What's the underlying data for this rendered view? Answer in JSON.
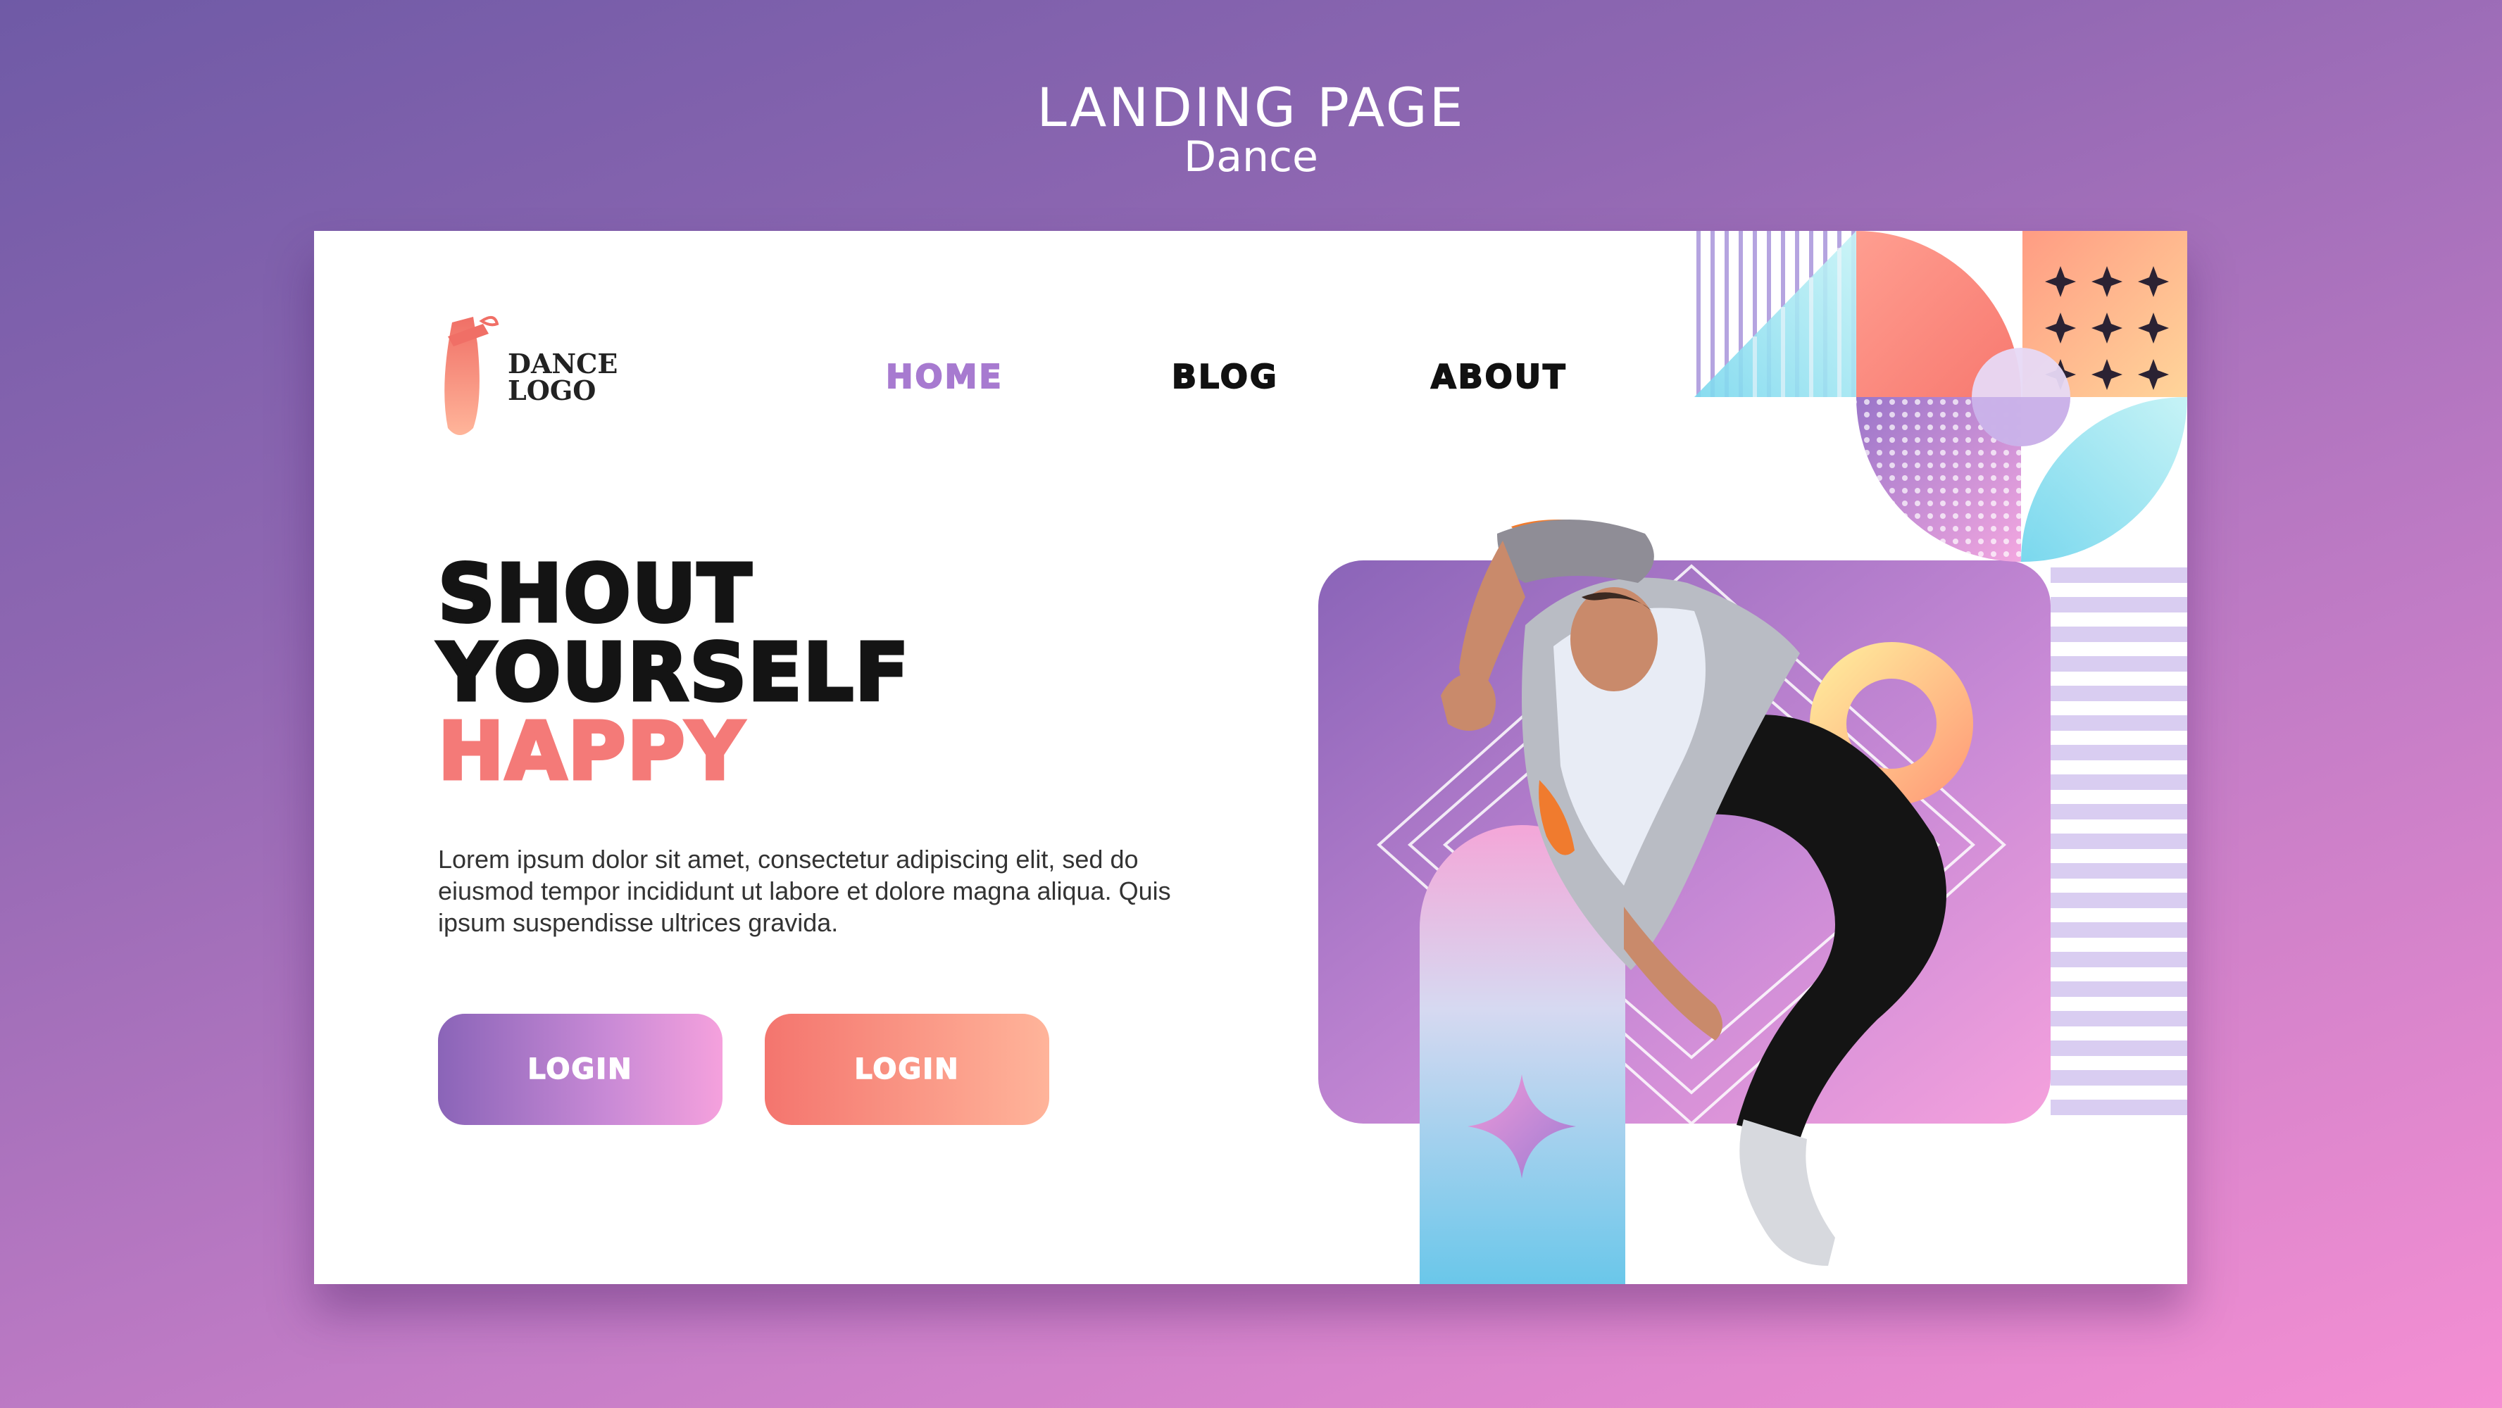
{
  "header": {
    "title": "LANDING PAGE",
    "subtitle": "Dance"
  },
  "logo": {
    "line1": "DANCE",
    "line2": "LOGO",
    "icon": "ballet-shoe-icon"
  },
  "nav": {
    "items": [
      "HOME",
      "BLOG",
      "ABOUT"
    ],
    "active": "HOME"
  },
  "hero": {
    "headline_line1": "SHOUT",
    "headline_line2": "YOURSELF",
    "headline_line3": "HAPPY",
    "body": "Lorem ipsum dolor sit amet, consectetur adipiscing elit, sed do eiusmod tempor incididunt ut labore et dolore magna aliqua. Quis ipsum suspendisse ultrices gravida."
  },
  "buttons": {
    "primary": "LOGIN",
    "secondary": "LOGIN"
  },
  "colors": {
    "accent_purple": "#a77ad0",
    "accent_coral": "#f47a78",
    "text_dark": "#141414"
  }
}
